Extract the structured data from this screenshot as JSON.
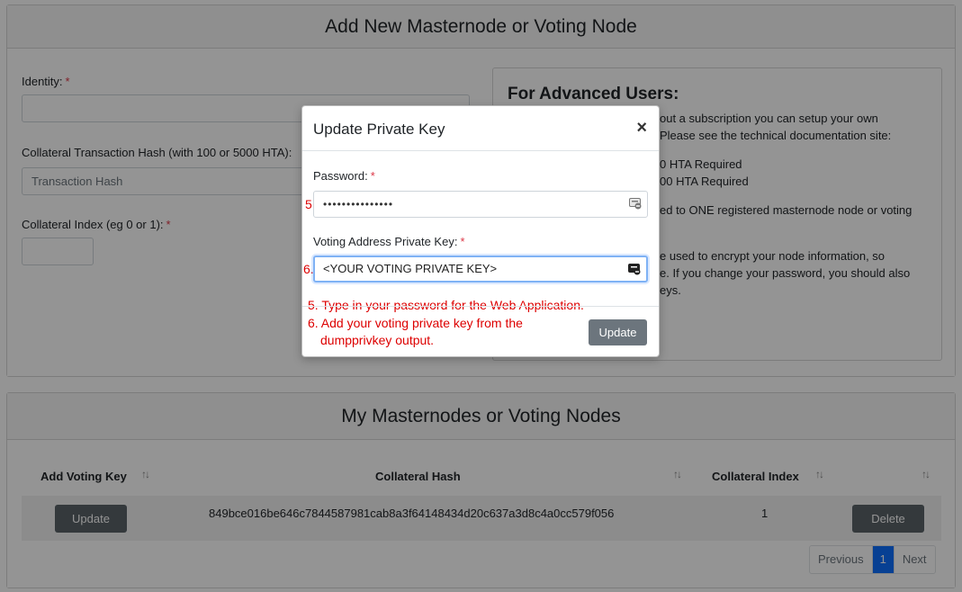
{
  "add_card": {
    "title": "Add New Masternode or Voting Node",
    "identity_label": "Identity:",
    "identity_value": "",
    "hash_label": "Collateral Transaction Hash (with 100 or 5000 HTA):",
    "hash_placeholder": "Transaction Hash",
    "index_label": "Collateral Index (eg 0 or 1):",
    "index_value": "",
    "required_mark": "*"
  },
  "advanced": {
    "title": "For Advanced Users:",
    "lines": [
      "out a subscription you can setup your own",
      "Please see the technical documentation site:",
      "0 HTA Required",
      "00 HTA Required",
      "ed to ONE registered masternode node or voting",
      "e used to encrypt your node information, so",
      "e. If you change your password, you should also",
      "eys."
    ]
  },
  "nodes_card": {
    "title": "My Masternodes or Voting Nodes",
    "columns": [
      "Add Voting Key",
      "Collateral Hash",
      "Collateral Index",
      ""
    ],
    "rows": [
      {
        "action": "Update",
        "hash": "849bce016be646c7844587981cab8a3f64148434d20c637a3d8c4a0cc579f056",
        "index": "1",
        "delete": "Delete"
      }
    ],
    "pagination": {
      "previous": "Previous",
      "current": "1",
      "next": "Next"
    }
  },
  "modal": {
    "title": "Update Private Key",
    "close": "×",
    "password_label": "Password:",
    "password_value": "•••••••••••••••",
    "voting_label": "Voting Address Private Key:",
    "voting_value": "<YOUR VOTING PRIVATE KEY>",
    "required_mark": "*",
    "step5": "5.",
    "step6": "6.",
    "note_1": "5. Type in your password for the Web Application.",
    "note_2a": "6. Add your voting private key from the",
    "note_2b": "dumpprivkey output.",
    "update_button": "Update"
  },
  "colors": {
    "annotation": "#dd0000",
    "primary": "#0d6efd",
    "secondary": "#6c757d",
    "required": "#dc3545"
  },
  "icons": [
    "key-icon",
    "sort-icon",
    "close-icon"
  ]
}
